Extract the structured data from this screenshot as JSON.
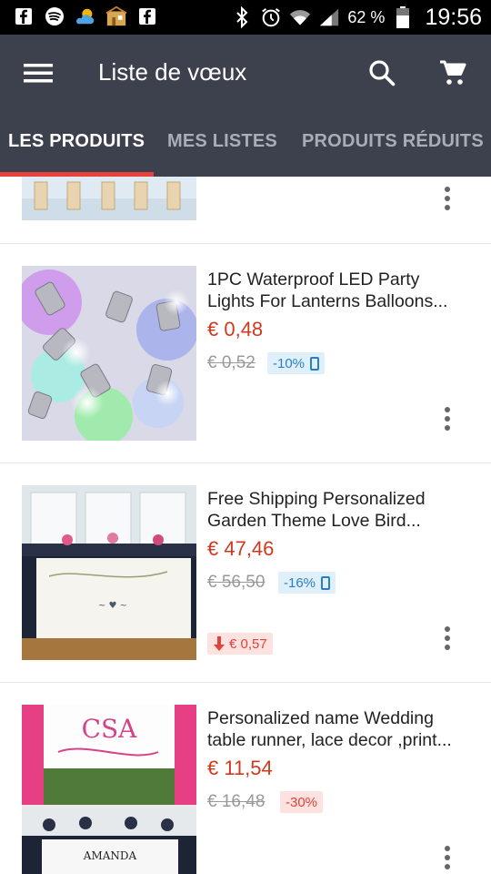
{
  "status_bar": {
    "battery": "62 %",
    "time": "19:56",
    "icons": [
      "facebook-icon",
      "spotify-icon",
      "weather-icon",
      "home-icon",
      "facebook-icon",
      "bluetooth-icon",
      "alarm-icon",
      "wifi-icon",
      "signal-icon",
      "battery-icon"
    ]
  },
  "app_bar": {
    "title": "Liste de vœux",
    "icons": [
      "menu-icon",
      "search-icon",
      "cart-icon"
    ],
    "tabs": [
      {
        "label": "LES PRODUITS",
        "active": true
      },
      {
        "label": "MES LISTES",
        "active": false
      },
      {
        "label": "PRODUITS RÉDUITS",
        "active": false
      }
    ]
  },
  "colors": {
    "app_bar": "#3d414d",
    "accent": "#e8403a",
    "price": "#d0391e",
    "discount_blue": "#2a7fc2"
  },
  "products": [
    {
      "title_line1": "1PC Waterproof LED Party",
      "title_line2": "Lights For Lanterns Balloons...",
      "price": "€ 0,48",
      "old_price": "€ 0,52",
      "discount": "-10%",
      "mobile_only": true
    },
    {
      "title_line1": "Free Shipping Personalized",
      "title_line2": "Garden Theme Love Bird...",
      "price": "€ 47,46",
      "old_price": "€ 56,50",
      "discount": "-16%",
      "mobile_only": true,
      "price_drop": "€ 0,57"
    },
    {
      "title_line1": "Personalized name Wedding",
      "title_line2": "table runner, lace decor ,print...",
      "price": "€ 11,54",
      "old_price": "€ 16,48",
      "discount": "-30%",
      "mobile_only": false
    }
  ],
  "thumb_text": {
    "p3_monogram": "CSA",
    "p3_name": "AMANDA"
  }
}
